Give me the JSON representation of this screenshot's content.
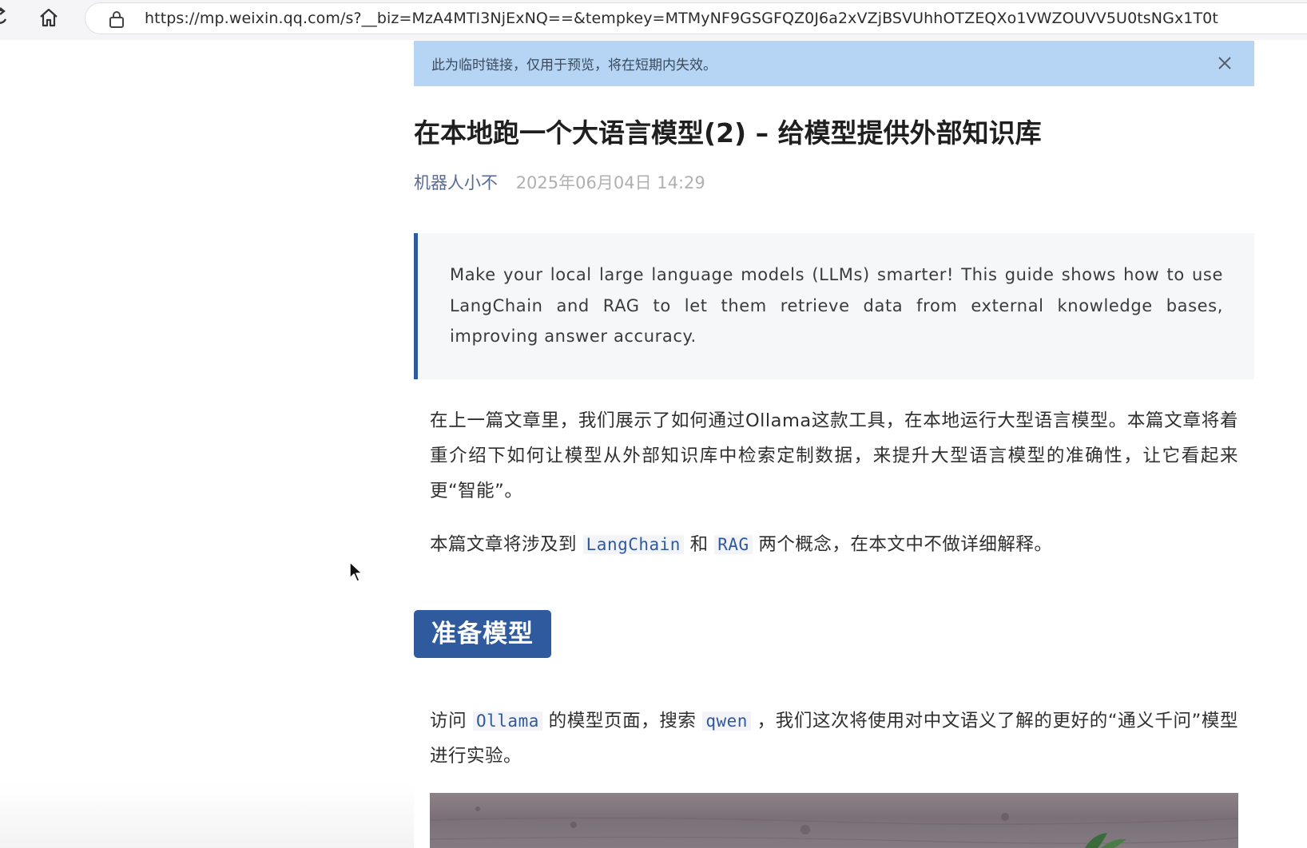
{
  "browser": {
    "url": "https://mp.weixin.qq.com/s?__biz=MzA4MTI3NjExNQ==&tempkey=MTMyNF9GSGFQZ0J6a2xVZjBSVUhhOTZEQXo1VWZOUVV5U0tsNGx1T0t",
    "icons": [
      "reload-icon",
      "home-icon",
      "lock-icon"
    ]
  },
  "notice": {
    "text": "此为临时链接，仅用于预览，将在短期内失效。",
    "close_icon": "close-icon",
    "background": "#b6d4f3"
  },
  "article": {
    "title": "在本地跑一个大语言模型(2) – 给模型提供外部知识库",
    "author": "机器人小不",
    "date": "2025年06月04日 14:29",
    "quote": "Make your local large language models (LLMs) smarter! This guide shows how to use LangChain and RAG to let them retrieve data from external knowledge bases, improving answer accuracy.",
    "para1": "在上一篇文章里，我们展示了如何通过Ollama这款工具，在本地运行大型语言模型。本篇文章将着重介绍下如何让模型从外部知识库中检索定制数据，来提升大型语言模型的准确性，让它看起来更“智能”。",
    "para2": {
      "before": "本篇文章将涉及到 ",
      "code1": "LangChain",
      "middle": " 和 ",
      "code2": "RAG",
      "after": " 两个概念，在本文中不做详细解释。"
    },
    "section_heading": "准备模型",
    "para3": {
      "before": "访问 ",
      "code1": "Ollama",
      "middle": " 的模型页面，搜索 ",
      "code2": "qwen",
      "after": " ，我们这次将使用对中文语义了解的更好的“通义千问”模型进行实验。"
    },
    "accent_color": "#2f5a9e",
    "author_color": "#576b95"
  }
}
